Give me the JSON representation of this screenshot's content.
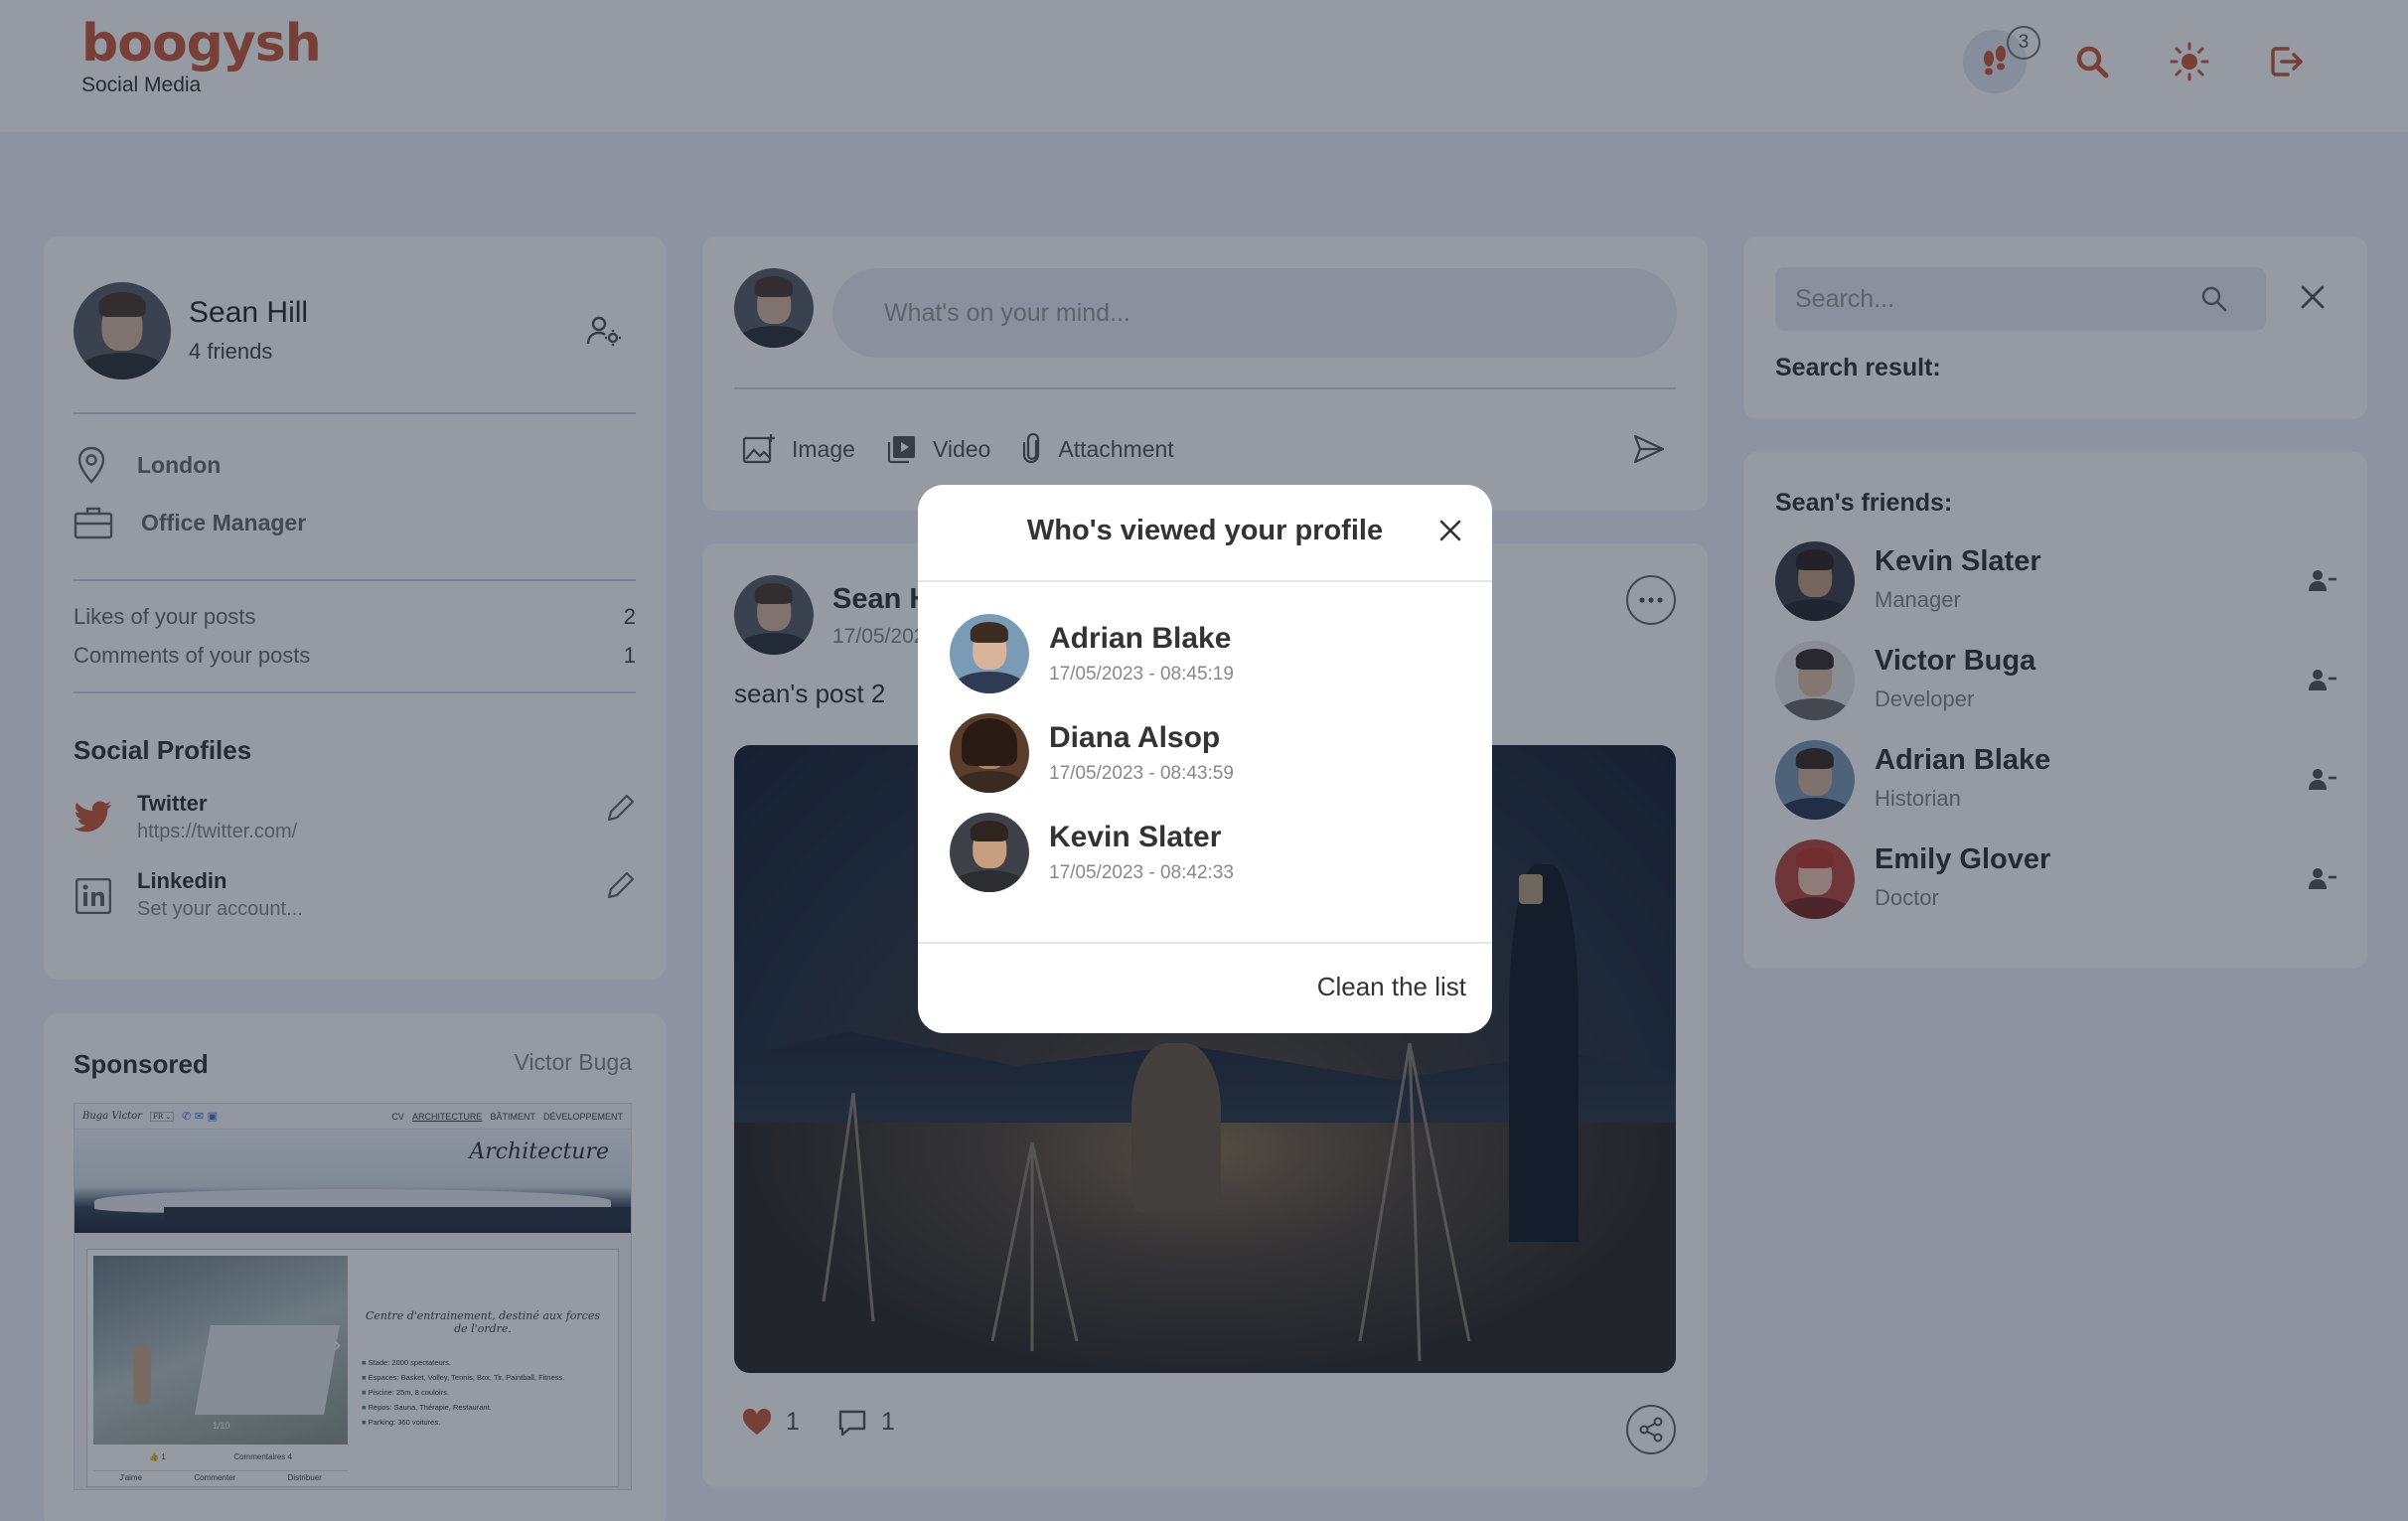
{
  "brand": {
    "name": "boogysh",
    "subtitle": "Social Media"
  },
  "header": {
    "notification_count": "3",
    "icons": [
      "footprints-icon",
      "search-icon",
      "sun-icon",
      "logout-icon"
    ],
    "accent_color": "#c85a3a"
  },
  "profile": {
    "name": "Sean Hill",
    "friends": "4 friends",
    "location": "London",
    "occupation": "Office Manager",
    "stats": [
      {
        "label": "Likes of your posts",
        "value": "2"
      },
      {
        "label": "Comments of your posts",
        "value": "1"
      }
    ],
    "social_title": "Social Profiles",
    "social": [
      {
        "name": "Twitter",
        "value": "https://twitter.com/"
      },
      {
        "name": "Linkedin",
        "value": "Set your account..."
      }
    ]
  },
  "sponsored": {
    "title": "Sponsored",
    "author": "Victor Buga",
    "ad": {
      "site_name": "Buga Victor",
      "nav": [
        "CV",
        "ARCHITECTURE",
        "BÂTIMENT",
        "DÉVELOPPEMENT"
      ],
      "heading": "Architecture",
      "caption": "Centre d'entrainement, destiné aux forces de l'ordre.",
      "bullets": [
        "Stade: 2000 spectateurs.",
        "Espaces: Basket, Volley, Tennis, Box, Tir, Paintball, Fitness.",
        "Piscine: 25m, 8 couloirs.",
        "Repos: Sauna, Thérapie, Restaurant.",
        "Parking: 360 voitures."
      ],
      "counter": "1/10",
      "likes": "1",
      "comments": "Commentaires 4",
      "actions": [
        "J'aime",
        "Commenter",
        "Distribuer"
      ]
    }
  },
  "composer": {
    "placeholder": "What's on your mind...",
    "actions": [
      "Image",
      "Video",
      "Attachment"
    ]
  },
  "post": {
    "author": "Sean Hill",
    "date": "17/05/2023",
    "text": "sean's post 2",
    "likes": "1",
    "comments": "1"
  },
  "search": {
    "placeholder": "Search...",
    "result_label": "Search result:"
  },
  "friends": {
    "title": "Sean's friends:",
    "items": [
      {
        "name": "Kevin Slater",
        "role": "Manager"
      },
      {
        "name": "Victor Buga",
        "role": "Developer"
      },
      {
        "name": "Adrian Blake",
        "role": "Historian"
      },
      {
        "name": "Emily Glover",
        "role": "Doctor"
      }
    ]
  },
  "modal": {
    "title": "Who's viewed your profile",
    "viewers": [
      {
        "name": "Adrian Blake",
        "time": "17/05/2023 - 08:45:19"
      },
      {
        "name": "Diana Alsop",
        "time": "17/05/2023 - 08:43:59"
      },
      {
        "name": "Kevin Slater",
        "time": "17/05/2023 - 08:42:33"
      }
    ],
    "clean_label": "Clean the list"
  }
}
